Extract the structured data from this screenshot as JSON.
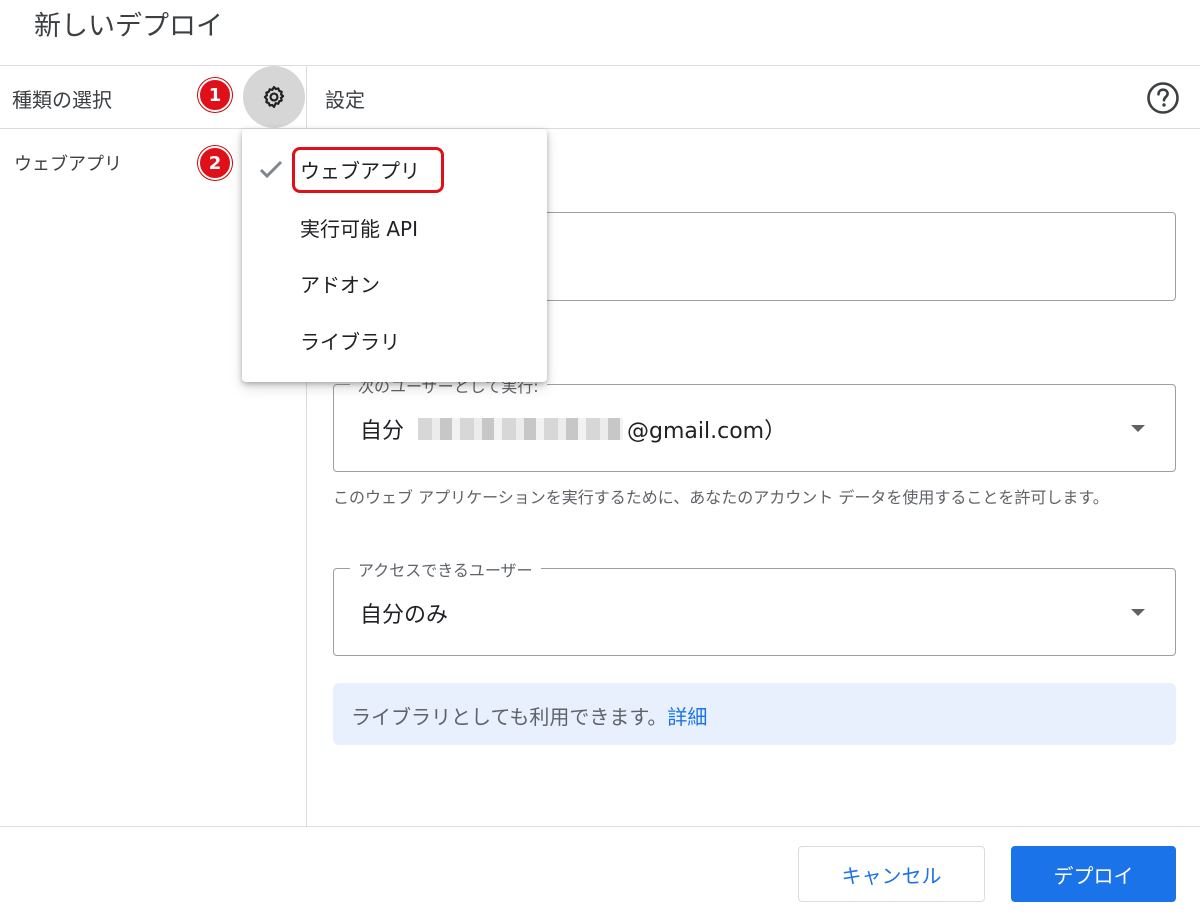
{
  "dialog": {
    "title": "新しいデプロイ"
  },
  "left_panel": {
    "header": "種類の選択",
    "selected_type": "ウェブアプリ"
  },
  "badges": {
    "one": "1",
    "two": "2"
  },
  "right_panel": {
    "header": "設定"
  },
  "type_menu": {
    "items": [
      {
        "label": "ウェブアプリ",
        "checked": true
      },
      {
        "label": "実行可能 API",
        "checked": false
      },
      {
        "label": "アドオン",
        "checked": false
      },
      {
        "label": "ライブラリ",
        "checked": false
      }
    ]
  },
  "execute_as": {
    "label": "次のユーザーとして実行:",
    "value_prefix": "自分",
    "value_suffix": "@gmail.com）"
  },
  "hint": "このウェブ アプリケーションを実行するために、あなたのアカウント データを使用することを許可します。",
  "access": {
    "label": "アクセスできるユーザー",
    "value": "自分のみ"
  },
  "info_banner": {
    "text": "ライブラリとしても利用できます。",
    "link": "詳細"
  },
  "footer": {
    "cancel": "キャンセル",
    "deploy": "デプロイ"
  },
  "colors": {
    "accent": "#1a73e8",
    "badge": "#e0101a",
    "banner_bg": "#e8f0fe"
  },
  "icons": {
    "gear": "gear-icon",
    "help": "help-icon",
    "check": "check-icon",
    "dropdown": "dropdown-arrow-icon"
  }
}
